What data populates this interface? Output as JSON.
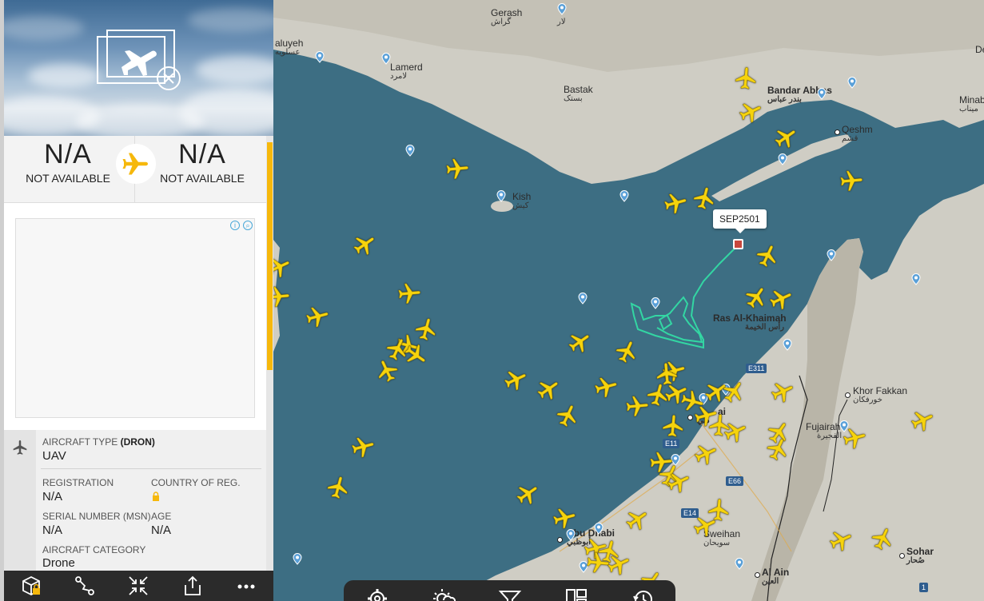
{
  "panel": {
    "origin": {
      "code": "N/A",
      "name": "NOT AVAILABLE"
    },
    "destination": {
      "code": "N/A",
      "name": "NOT AVAILABLE"
    },
    "aircraft_type_label": "AIRCRAFT TYPE",
    "aircraft_type_code": "(DRON)",
    "aircraft_type_value": "UAV",
    "registration_label": "REGISTRATION",
    "registration_value": "N/A",
    "country_label": "COUNTRY OF REG.",
    "serial_label": "SERIAL NUMBER (MSN)",
    "serial_value": "N/A",
    "age_label": "AGE",
    "age_value": "N/A",
    "category_label": "AIRCRAFT CATEGORY",
    "category_value": "Drone",
    "accent_color": "#f6b80c"
  },
  "map": {
    "selected_callsign": "SEP2501",
    "track_color": "#33d6a3",
    "plane_color": "#f6d30c",
    "places": {
      "gerash": {
        "en": "Gerash",
        "ar": "گراش"
      },
      "lar": {
        "en": "",
        "ar": "لار"
      },
      "aluyeh": {
        "en": "aluyeh",
        "ar": "عسلویه"
      },
      "lamerd": {
        "en": "Lamerd",
        "ar": "لامرد"
      },
      "bastak": {
        "en": "Bastak",
        "ar": "بستک"
      },
      "bandar_abbas": {
        "en": "Bandar Abbas",
        "ar": "بندر عباس"
      },
      "qeshm": {
        "en": "Qeshm",
        "ar": "قشم"
      },
      "minab": {
        "en": "Minab",
        "ar": "میناب"
      },
      "kish": {
        "en": "Kish",
        "ar": "کیش"
      },
      "ras_al_khaimah": {
        "en": "Ras Al-Khaimah",
        "ar": "رأس الخيمة"
      },
      "khor_fakkan": {
        "en": "Khor Fakkan",
        "ar": "خورفكان"
      },
      "fujairah": {
        "en": "Fujairah",
        "ar": "الفجيرة"
      },
      "dubai": {
        "en": "ai",
        "ar": "دبي"
      },
      "abu_dhabi": {
        "en": "Abu Dhabi",
        "ar": "أبوظبي"
      },
      "sweihan": {
        "en": "Sweihan",
        "ar": "سويحان"
      },
      "al_ain": {
        "en": "Al Ain",
        "ar": "العين"
      },
      "sohar": {
        "en": "Sohar",
        "ar": "صُحار"
      },
      "de": {
        "en": "De",
        "ar": ""
      }
    },
    "road_signs": [
      "E311",
      "E11",
      "E66",
      "E14",
      "1"
    ]
  }
}
